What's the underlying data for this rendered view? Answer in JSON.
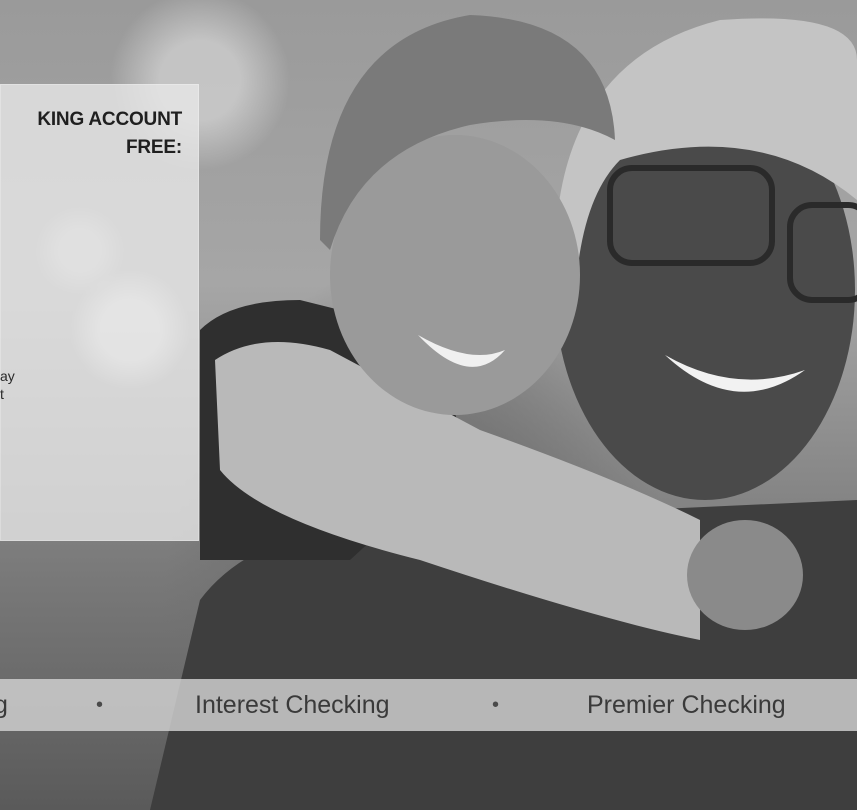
{
  "promo": {
    "title_line1": "KING ACCOUNT",
    "title_line2": "FREE:",
    "body_line1": "ay",
    "body_line2": "t"
  },
  "accounts": {
    "partial_label": "g",
    "separator": "•",
    "items": [
      "Interest Checking",
      "Premier Checking"
    ]
  },
  "colors": {
    "card_bg": "#e8e8e8",
    "strip_bg": "#d2d2d2",
    "text_dark": "#1f1f1f"
  }
}
